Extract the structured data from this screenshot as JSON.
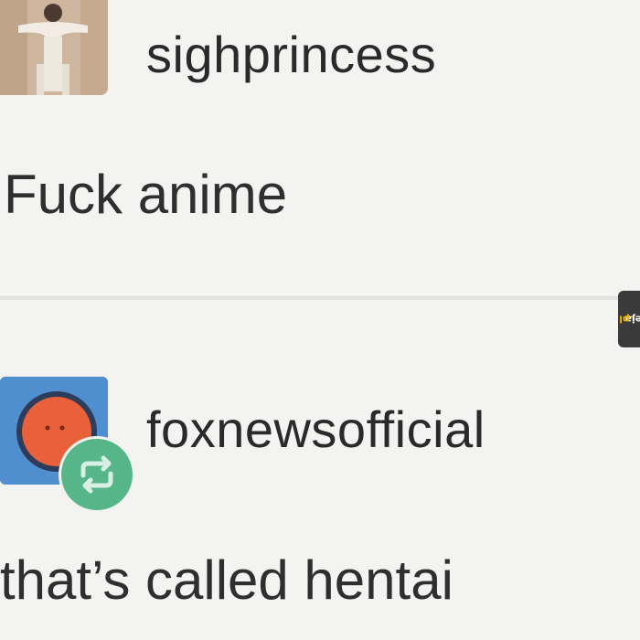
{
  "posts": [
    {
      "username": "sighprincess",
      "text": "Fuck anime",
      "avatar_icon": "person-photo-icon"
    },
    {
      "username": "foxnewsofficial",
      "text": "that’s called hentai",
      "avatar_icon": "orange-face-icon",
      "badge_icon": "reblog-icon"
    }
  ],
  "watermark": {
    "text": "jeja",
    "suffix": ".pl"
  },
  "colors": {
    "background": "#f3f3f1",
    "avatar_blue": "#4f8fcf",
    "reblog_green": "#56b68a",
    "avatar_orange": "#e8613a"
  }
}
